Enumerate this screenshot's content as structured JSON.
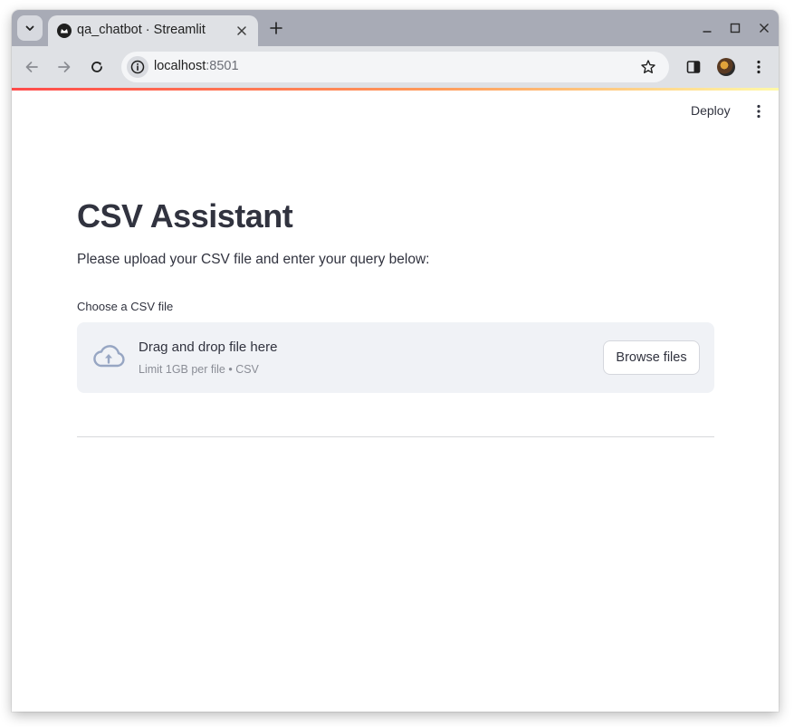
{
  "browser": {
    "tab": {
      "title": "qa_chatbot · Streamlit",
      "favicon": "streamlit-crown-icon"
    },
    "address": {
      "host": "localhost",
      "port": ":8501"
    },
    "icons": {
      "tab_search": "chevron-down-icon",
      "tab_close": "close-icon",
      "new_tab": "plus-icon",
      "back": "back-arrow-icon",
      "forward": "forward-arrow-icon",
      "reload": "reload-icon",
      "site_info": "info-icon",
      "bookmark": "star-icon",
      "side_panel": "side-panel-icon",
      "profile": "avatar",
      "menu": "kebab-menu-icon",
      "minimize": "minimize-icon",
      "maximize": "maximize-icon",
      "close_window": "close-icon"
    }
  },
  "app": {
    "header": {
      "deploy_label": "Deploy",
      "menu_icon": "kebab-menu-icon"
    },
    "title": "CSV Assistant",
    "description": "Please upload your CSV file and enter your query below:",
    "uploader": {
      "label": "Choose a CSV file",
      "dropzone_text": "Drag and drop file here",
      "limit_text": "Limit 1GB per file • CSV",
      "button_label": "Browse files",
      "icon": "cloud-upload-icon"
    }
  },
  "colors": {
    "accent_gradient": [
      "#ff4b4b",
      "#ff9a5a",
      "#fff9a8"
    ],
    "text": "#31333f",
    "dropzone_bg": "#f0f2f6",
    "upload_icon": "#97a6c3"
  }
}
